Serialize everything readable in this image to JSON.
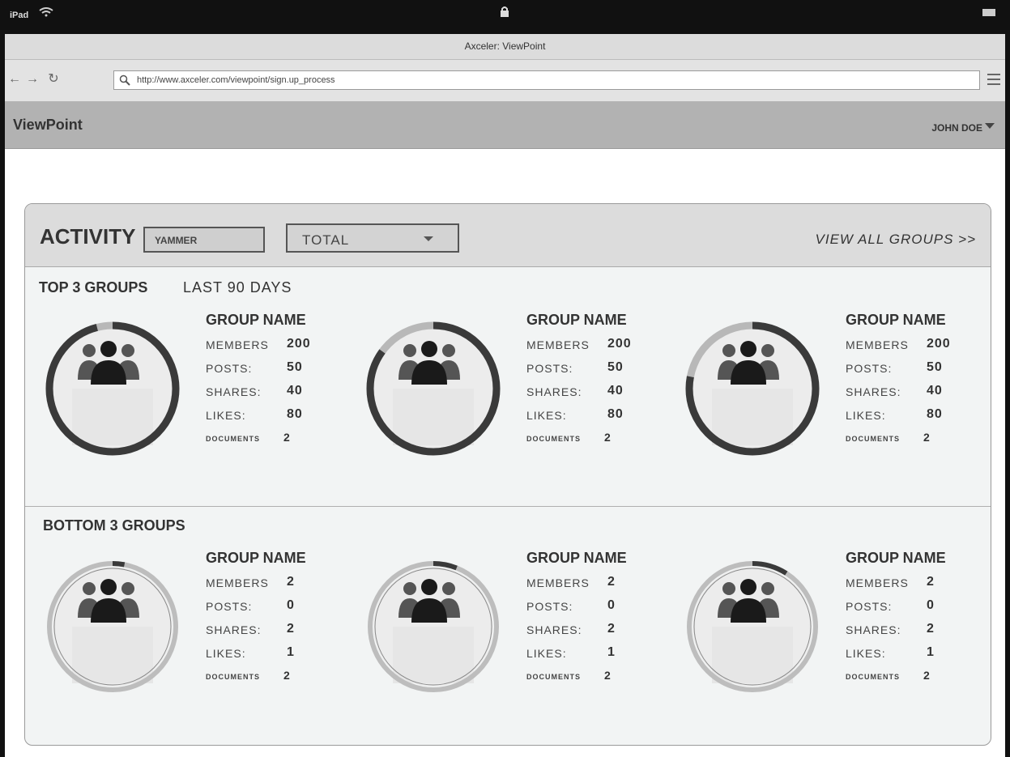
{
  "device": {
    "carrier": "iPad",
    "window_title": "Axceler: ViewPoint"
  },
  "browser": {
    "url": "http://www.axceler.com/viewpoint/sign.up_process"
  },
  "app": {
    "brand": "ViewPoint",
    "user": "JOHN DOE"
  },
  "activity": {
    "title": "ACTIVITY",
    "source_select": "YAMMER",
    "metric_select": "TOTAL",
    "view_all": "VIEW ALL GROUPS >>",
    "top_label": "TOP 3 GROUPS",
    "period": "LAST 90 DAYS",
    "bottom_label": "BOTTOM 3 GROUPS",
    "labels": {
      "members": "MEMBERS",
      "posts": "POSTS:",
      "shares": "SHARES:",
      "likes": "LIKES:",
      "documents": "DOCUMENTS"
    },
    "top": [
      {
        "name": "GROUP NAME",
        "members": "200",
        "posts": "50",
        "shares": "40",
        "likes": "80",
        "documents": "2",
        "progress": 0.96
      },
      {
        "name": "GROUP NAME",
        "members": "200",
        "posts": "50",
        "shares": "40",
        "likes": "80",
        "documents": "2",
        "progress": 0.85
      },
      {
        "name": "GROUP NAME",
        "members": "200",
        "posts": "50",
        "shares": "40",
        "likes": "80",
        "documents": "2",
        "progress": 0.78
      }
    ],
    "bottom": [
      {
        "name": "GROUP NAME",
        "members": "2",
        "posts": "0",
        "shares": "2",
        "likes": "1",
        "documents": "2",
        "progress": 0.03
      },
      {
        "name": "GROUP NAME",
        "members": "2",
        "posts": "0",
        "shares": "2",
        "likes": "1",
        "documents": "2",
        "progress": 0.06
      },
      {
        "name": "GROUP NAME",
        "members": "2",
        "posts": "0",
        "shares": "2",
        "likes": "1",
        "documents": "2",
        "progress": 0.09
      }
    ]
  }
}
